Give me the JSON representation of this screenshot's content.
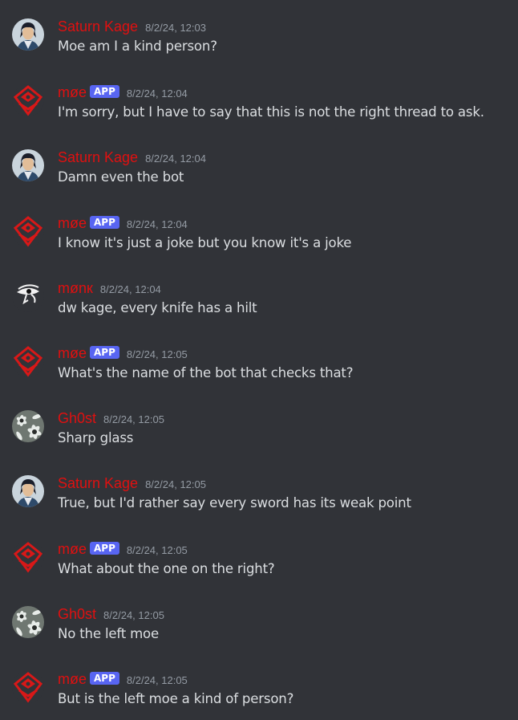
{
  "colors": {
    "background": "#313338",
    "username": "#e01010",
    "timestamp": "#949ba4",
    "message_text": "#dbdee1",
    "app_badge": "#5865f2"
  },
  "messages": [
    {
      "author": "Saturn Kage",
      "avatar": "saturn-kage-avatar",
      "badge": "",
      "timestamp": "8/2/24, 12:03",
      "text": "Moe am I a kind person?"
    },
    {
      "author": "møe",
      "avatar": "moe-logo-avatar",
      "badge": "APP",
      "timestamp": "8/2/24, 12:04",
      "text": "I'm sorry, but I have to say that this is not the right thread to ask."
    },
    {
      "author": "Saturn Kage",
      "avatar": "saturn-kage-avatar",
      "badge": "",
      "timestamp": "8/2/24, 12:04",
      "text": "Damn even the bot"
    },
    {
      "author": "møe",
      "avatar": "moe-logo-avatar",
      "badge": "APP",
      "timestamp": "8/2/24, 12:04",
      "text": "I know it's just a joke but you know it's a joke"
    },
    {
      "author": "mønк",
      "avatar": "eye-of-horus-avatar",
      "badge": "",
      "timestamp": "8/2/24, 12:04",
      "text": "dw kage, every knife has a hilt"
    },
    {
      "author": "møe",
      "avatar": "moe-logo-avatar",
      "badge": "APP",
      "timestamp": "8/2/24, 12:05",
      "text": "What's the name of the bot that checks that?"
    },
    {
      "author": "Gh0st",
      "avatar": "flowers-avatar",
      "badge": "",
      "timestamp": "8/2/24, 12:05",
      "text": "Sharp glass"
    },
    {
      "author": "Saturn Kage",
      "avatar": "saturn-kage-avatar",
      "badge": "",
      "timestamp": "8/2/24, 12:05",
      "text": "True, but I'd rather say every sword has its weak point"
    },
    {
      "author": "møe",
      "avatar": "moe-logo-avatar",
      "badge": "APP",
      "timestamp": "8/2/24, 12:05",
      "text": "What about the one on the right?"
    },
    {
      "author": "Gh0st",
      "avatar": "flowers-avatar",
      "badge": "",
      "timestamp": "8/2/24, 12:05",
      "text": "No the left moe"
    },
    {
      "author": "møe",
      "avatar": "moe-logo-avatar",
      "badge": "APP",
      "timestamp": "8/2/24, 12:05",
      "text": "But is the left moe a kind of person?"
    }
  ]
}
